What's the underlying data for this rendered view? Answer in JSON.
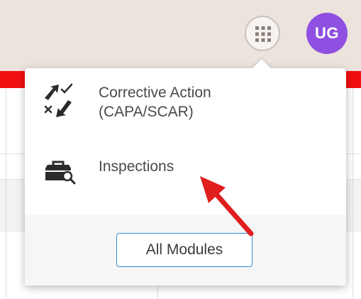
{
  "header": {
    "apps_button_icon": "grid-icon",
    "avatar_initials": "UG",
    "colors": {
      "header_bg": "#ece3dd",
      "accent_bar": "#f20f0f",
      "avatar_bg": "#8f4fe0"
    }
  },
  "apps_menu": {
    "items": [
      {
        "label_line1": "Corrective Action",
        "label_line2": "(CAPA/SCAR)",
        "icon": "corrective-action-icon"
      },
      {
        "label": "Inspections",
        "icon": "inspections-toolbox-icon"
      }
    ],
    "all_modules_label": "All Modules",
    "button_border_color": "#2f8bd3"
  },
  "annotation": {
    "type": "red-arrow",
    "color": "#e01e1e",
    "points_to": "Inspections"
  }
}
